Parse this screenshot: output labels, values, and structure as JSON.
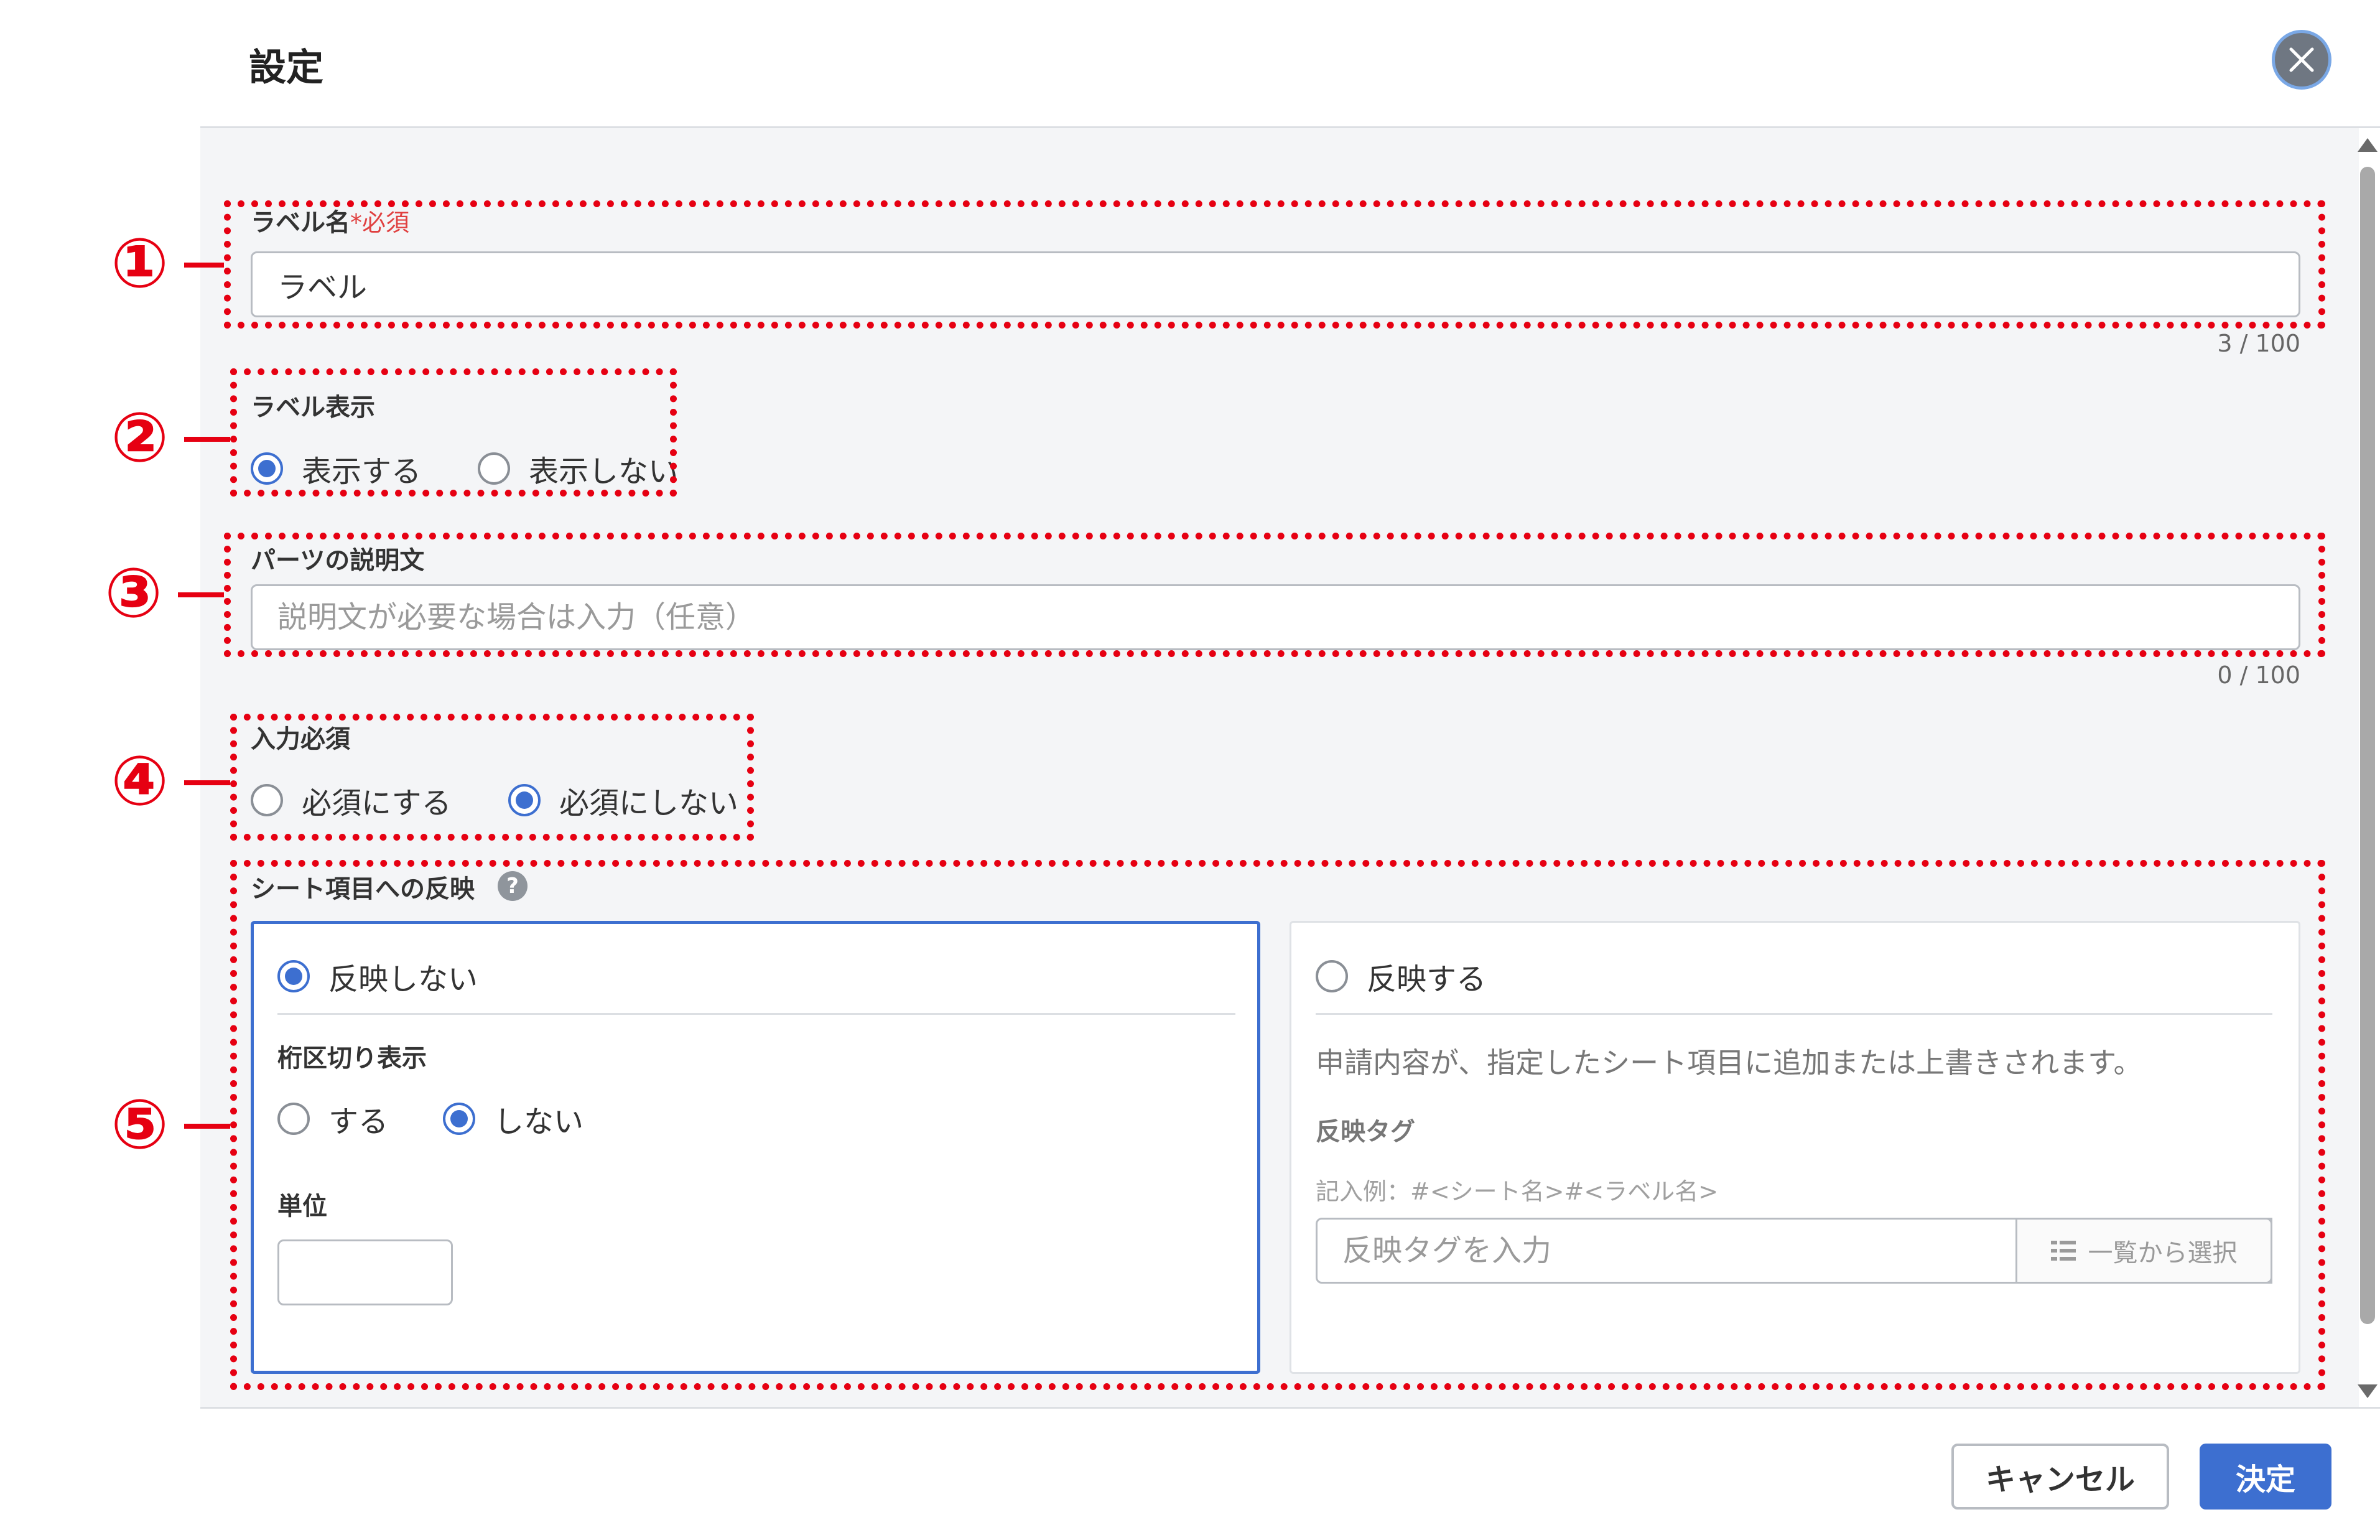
{
  "dialog": {
    "title": "設定"
  },
  "annotations": [
    "①",
    "②",
    "③",
    "④",
    "⑤"
  ],
  "label_name": {
    "label": "ラベル名",
    "required_mark": "*必須",
    "value": "ラベル",
    "counter": "3 / 100"
  },
  "label_display": {
    "label": "ラベル表示",
    "options": [
      {
        "label": "表示する",
        "checked": true
      },
      {
        "label": "表示しない",
        "checked": false
      }
    ]
  },
  "description": {
    "label": "パーツの説明文",
    "placeholder": "説明文が必要な場合は入力（任意）",
    "counter": "0 / 100"
  },
  "required_setting": {
    "label": "入力必須",
    "options": [
      {
        "label": "必須にする",
        "checked": false
      },
      {
        "label": "必須にしない",
        "checked": true
      }
    ]
  },
  "sheet_reflect": {
    "label": "シート項目への反映",
    "help_icon": "?",
    "no_reflect": {
      "label": "反映しない",
      "checked": true,
      "separator_label": "桁区切り表示",
      "separator_options": [
        {
          "label": "する",
          "checked": false
        },
        {
          "label": "しない",
          "checked": true
        }
      ],
      "unit_label": "単位",
      "unit_value": ""
    },
    "reflect": {
      "label": "反映する",
      "checked": false,
      "description": "申請内容が、指定したシート項目に追加または上書きされます。",
      "tag_label": "反映タグ",
      "example": "記入例：#<シート名>#<ラベル名>",
      "tag_placeholder": "反映タグを入力",
      "list_select": "一覧から選択"
    }
  },
  "footer": {
    "cancel": "キャンセル",
    "ok": "決定"
  },
  "colors": {
    "accent": "#3d6fd0",
    "annotation": "#e60012",
    "required": "#e04040"
  },
  "icons": {
    "close": "close-icon",
    "help": "help-icon",
    "list": "list-icon"
  }
}
